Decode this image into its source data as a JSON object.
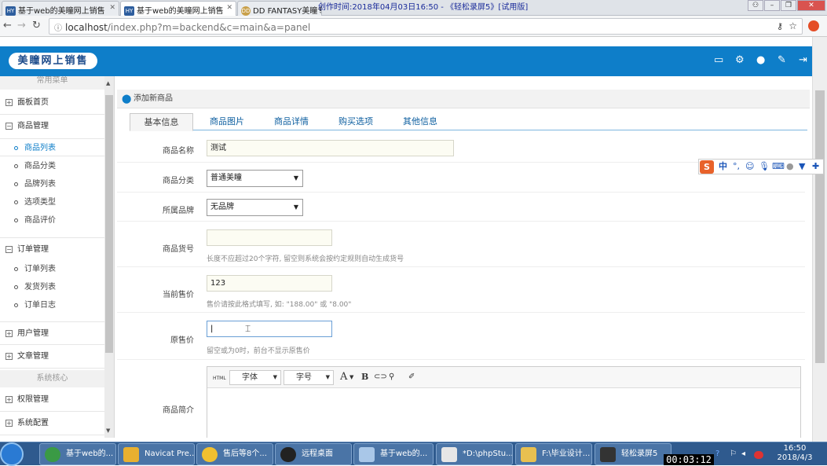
{
  "browser": {
    "tabs": [
      {
        "favicon": "HY",
        "title": "基于web的美瞳网上销售"
      },
      {
        "favicon": "HY",
        "title": "基于web的美瞳网上销售"
      },
      {
        "favicon": "DD",
        "title": "DD FANTASY美瞳专网"
      }
    ],
    "recorder_title": "创作时间:2018年04月03日16:50 - 《轻松录屏5》[试用版]",
    "url_host": "localhost",
    "url_path": "/index.php?m=backend&c=main&a=panel"
  },
  "header": {
    "logo_text": "美瞳网上销售",
    "icons": [
      "monitor-icon",
      "gear-icon",
      "user-icon",
      "brush-icon",
      "logout-icon"
    ]
  },
  "sidebar": {
    "section_top": "常用菜单",
    "home": "面板首页",
    "goods": {
      "label": "商品管理",
      "items": [
        "商品列表",
        "商品分类",
        "品牌列表",
        "选项类型",
        "商品评价"
      ]
    },
    "orders": {
      "label": "订单管理",
      "items": [
        "订单列表",
        "发货列表",
        "订单日志"
      ]
    },
    "users": "用户管理",
    "articles": "文章管理",
    "section_core": "系统核心",
    "permissions": "权限管理",
    "settings": "系统配置"
  },
  "content": {
    "panel_title": "添加新商品",
    "tabs": [
      "基本信息",
      "商品图片",
      "商品详情",
      "购买选项",
      "其他信息"
    ],
    "form": {
      "name_label": "商品名称",
      "name_value": "测试",
      "category_label": "商品分类",
      "category_value": "普通美瞳",
      "brand_label": "所属品牌",
      "brand_value": "无品牌",
      "sku_label": "商品货号",
      "sku_value": "",
      "sku_hint": "长度不应超过20个字符, 留空则系统会按约定规则自动生成货号",
      "price_label": "当前售价",
      "price_value": "123",
      "price_hint": "售价请按此格式填写, 如: \"188.00\" 或 \"8.00\"",
      "orig_price_label": "原售价",
      "orig_price_value": "",
      "orig_price_hint": "留空或为0时，前台不显示原售价",
      "intro_label": "商品简介"
    },
    "editor": {
      "html_btn": "HTML",
      "font_label": "字体",
      "size_label": "字号",
      "color_btn": "A",
      "bold_btn": "B"
    }
  },
  "ime": {
    "logo": "S",
    "mode": "中"
  },
  "taskbar": {
    "items": [
      "基于web的...",
      "Navicat Pre...",
      "售后等8个...",
      "远程桌面",
      "基于web的...",
      "*D:\\phpStu...",
      "F:\\毕业设计...",
      "轻松录屏5"
    ],
    "timer": "00:03:12",
    "time": "16:50",
    "date": "2018/4/3"
  }
}
